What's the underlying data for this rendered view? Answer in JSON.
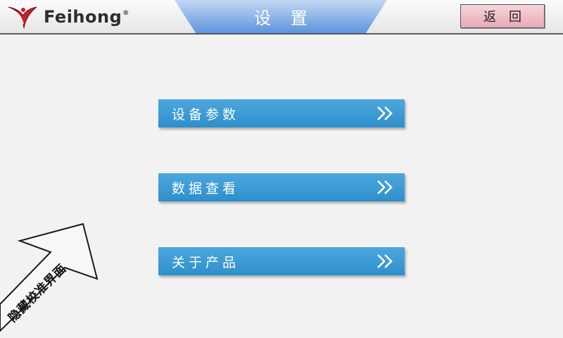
{
  "header": {
    "brand": "Feihong",
    "registered_mark": "®",
    "title": "设 置",
    "back_label": "返回"
  },
  "menu": [
    {
      "label": "设备参数",
      "icon": "double-chevron-right-icon"
    },
    {
      "label": "数据查看",
      "icon": "double-chevron-right-icon"
    },
    {
      "label": "关于产品",
      "icon": "double-chevron-right-icon"
    }
  ],
  "calibration": {
    "label": "隐藏校准界面"
  },
  "colors": {
    "background": "#f2f2f2",
    "menu_button": "#3a9bd5",
    "title_band": "#7aa9e6",
    "back_button": "#eebcc5",
    "logo_red": "#c8202a"
  }
}
